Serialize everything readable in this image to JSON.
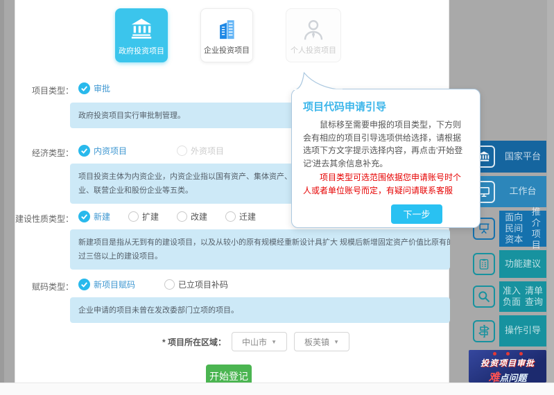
{
  "colors": {
    "overlay_gray": "#a9a9a9",
    "selected_card_cyan": "#3bc5ec",
    "check_cyan": "#29b9ec",
    "selected_option_blue": "#3e97d1",
    "info_box_blue": "#cde9f7",
    "submit_green": "#4bb551",
    "popup_title_cyan": "#3cb6ea",
    "warning_red": "#e60000",
    "next_button_cyan": "#29c1f2",
    "sidebar_dark_blue": "#15659f",
    "sidebar_mid_blue": "#2c86ba",
    "sidebar_blue": "#1571ad",
    "sidebar_teal": "#17929f"
  },
  "cards": [
    {
      "label": "政府投资项目",
      "state": "selected"
    },
    {
      "label": "企业投资项目",
      "state": "normal"
    },
    {
      "label": "个人投资项目",
      "state": "disabled"
    }
  ],
  "form": {
    "rows": [
      {
        "label": "项目类型：",
        "options": [
          {
            "label": "审批",
            "state": "checked"
          }
        ],
        "info_lines": [
          "政府投资项目实行审批制管理。"
        ]
      },
      {
        "label": "经济类型：",
        "options": [
          {
            "label": "内资项目",
            "state": "checked"
          },
          {
            "label": "外资项目",
            "state": "disabled"
          }
        ],
        "info_lines": [
          "项目投资主体为内资企业，内资企业指以国有资产、集体资产、国内个人资产",
          "业、联营企业和股份企业等五类。"
        ]
      },
      {
        "label": "建设性质类型：",
        "options": [
          {
            "label": "新建",
            "state": "checked"
          },
          {
            "label": "扩建",
            "state": "unchecked"
          },
          {
            "label": "改建",
            "state": "unchecked"
          },
          {
            "label": "迁建",
            "state": "unchecked"
          }
        ],
        "info_lines": [
          "新建项目是指从无到有的建设项目，以及从较小的原有规模经重新设计具扩大 规模后新增固定资产价值比原有的固定资产价值 超",
          "过三倍以上的建设项目。"
        ]
      },
      {
        "label": "赋码类型：",
        "options": [
          {
            "label": "新项目赋码",
            "state": "checked"
          },
          {
            "label": "已立项目补码",
            "state": "unchecked"
          }
        ],
        "info_lines": [
          "企业申请的项目未曾在发改委部门立项的项目。"
        ]
      }
    ],
    "region_label": "* 项目所在区域：",
    "region_selects": [
      "中山市",
      "板芙镇"
    ],
    "submit_label": "开始登记"
  },
  "popup": {
    "title": "项目代码申请引导",
    "body": "鼠标移至需要申报的项目类型，下方则会有相应的项目引导选项供给选择，请根据选项下方文字提示选择内容，再点击'开始登记'进去其余信息补充。",
    "warning": "项目类型可选范围依据您申请账号时个人或者单位账号而定，有疑问请联系客服",
    "next_label": "下一步"
  },
  "sidebar": {
    "items": [
      {
        "label": "国家平台",
        "icon": "bank-icon"
      },
      {
        "label": "工作台",
        "icon": "workbench-icon"
      },
      {
        "label_line1": "面向民间资本",
        "label_line2": "推介项目",
        "icon": "presentation-icon"
      },
      {
        "label": "功能建议",
        "icon": "clipboard-icon"
      },
      {
        "label_line1": "准入负面",
        "label_line2": "清单查询",
        "icon": "search-icon"
      },
      {
        "label": "操作引导",
        "icon": "signpost-icon"
      }
    ],
    "banner": {
      "line1": "投资项目审批",
      "line2_accent": "难",
      "line2_rest": "点问题"
    }
  }
}
